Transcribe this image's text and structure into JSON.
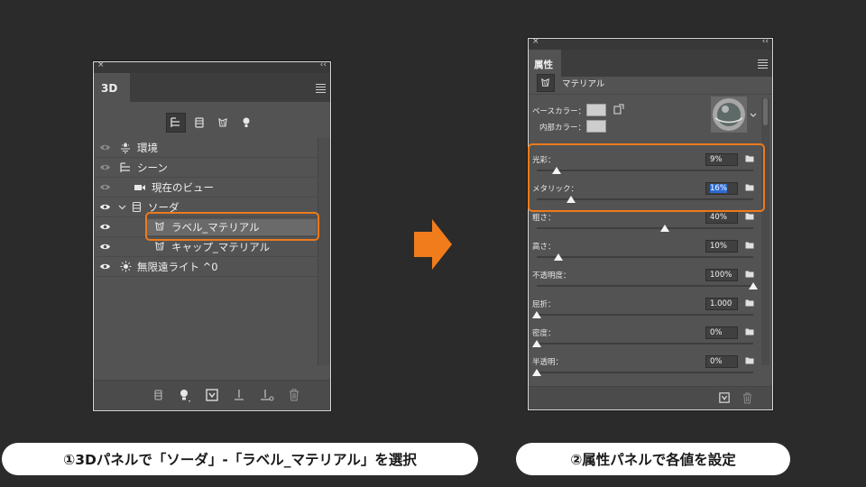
{
  "panel3d": {
    "close_glyph": "×",
    "collapse_glyph": "‹‹",
    "tab_label": "3D",
    "tools": [
      "scene-filter-icon",
      "mesh-filter-icon",
      "material-filter-icon",
      "light-filter-icon"
    ],
    "tree": [
      {
        "label": "環境",
        "icon": "environment-icon",
        "eye": "dim"
      },
      {
        "label": "シーン",
        "icon": "scene-icon",
        "eye": "dim"
      },
      {
        "label": "現在のビュー",
        "icon": "camera-icon",
        "eye": "dim"
      },
      {
        "label": "ソーダ",
        "icon": "mesh-icon",
        "eye": "on"
      },
      {
        "label": "ラベル_マテリアル",
        "icon": "material-icon",
        "eye": "on",
        "selected": true
      },
      {
        "label": "キャップ_マテリアル",
        "icon": "material-icon",
        "eye": "on"
      },
      {
        "label": "無限遠ライト ^0",
        "icon": "light-icon",
        "eye": "on"
      }
    ]
  },
  "properties": {
    "close_glyph": "×",
    "collapse_glyph": "‹‹",
    "tab_label": "属性",
    "section_title": "マテリアル",
    "base_color_label": "ベースカラー：",
    "inner_color_label": "内部カラー：",
    "rows": [
      {
        "label": "光彩：",
        "value": "9%",
        "level": 0.09
      },
      {
        "label": "メタリック：",
        "value": "16%",
        "level": 0.16,
        "active": true
      },
      {
        "label": "粗さ：",
        "value": "40%",
        "level": 0.59
      },
      {
        "label": "高さ：",
        "value": "10%",
        "level": 0.1
      },
      {
        "label": "不透明度：",
        "value": "100%",
        "level": 1.0
      },
      {
        "label": "屈折：",
        "value": "1.000",
        "level": 0.0
      },
      {
        "label": "密度：",
        "value": "0%",
        "level": 0.0
      },
      {
        "label": "半透明：",
        "value": "0%",
        "level": 0.0
      }
    ]
  },
  "captions": {
    "left": "①3Dパネルで「ソーダ」-「ラベル_マテリアル」を選択",
    "right": "②属性パネルで各値を設定"
  },
  "colors": {
    "highlight": "#ec7a1c",
    "arrow": "#f07c1c",
    "panel_bg": "#535353",
    "page_bg": "#2b2b2b"
  }
}
